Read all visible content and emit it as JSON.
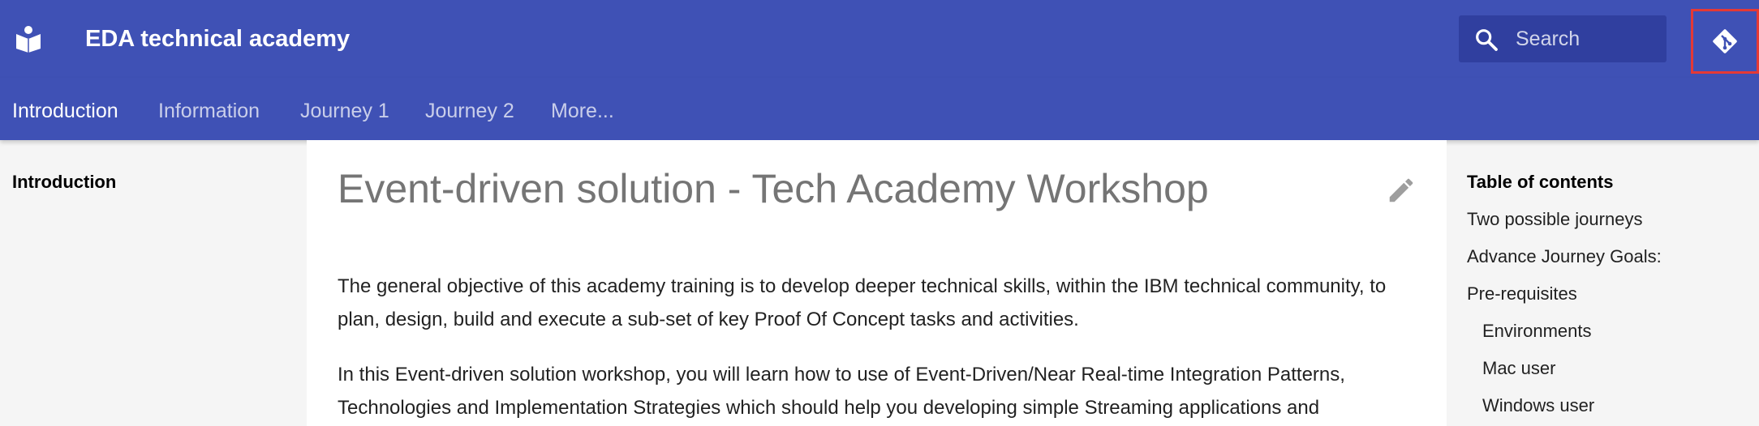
{
  "header": {
    "title": "EDA technical academy",
    "logo_icon": "book-reader-icon",
    "git_icon": "git-icon",
    "accent_color": "#3f51b5",
    "highlight_color": "#e53935"
  },
  "search": {
    "placeholder": "Search",
    "icon": "search-icon"
  },
  "tabs": [
    {
      "label": "Introduction"
    },
    {
      "label": "Information"
    },
    {
      "label": "Journey 1"
    },
    {
      "label": "Journey 2"
    },
    {
      "label": "More..."
    }
  ],
  "left_nav": {
    "items": [
      {
        "label": "Introduction"
      }
    ]
  },
  "main": {
    "title": "Event-driven solution - Tech Academy Workshop",
    "edit_icon": "pencil-icon",
    "paragraphs": [
      "The general objective of this academy training is to develop deeper technical skills, within the IBM technical community, to plan, design, build and execute a sub-set of key Proof Of Concept tasks and activities.",
      "In this Event-driven solution workshop, you will learn how to use of Event-Driven/Near Real-time Integration Patterns, Technologies and Implementation Strategies which should help you developing simple Streaming applications and"
    ]
  },
  "toc": {
    "title": "Table of contents",
    "items": [
      {
        "label": "Two possible journeys"
      },
      {
        "label": "Advance Journey Goals:"
      },
      {
        "label": "Pre-requisites"
      },
      {
        "label": "Environments"
      },
      {
        "label": "Mac user"
      },
      {
        "label": "Windows user"
      }
    ]
  }
}
